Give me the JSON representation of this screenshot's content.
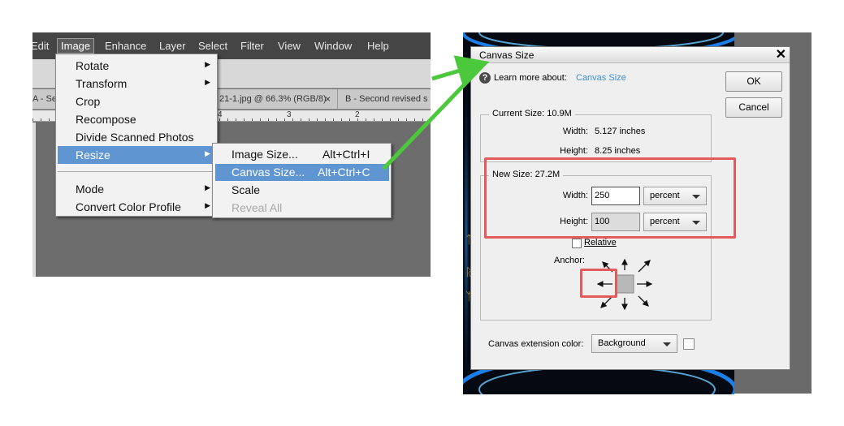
{
  "editor": {
    "menubar": [
      "Edit",
      "Image",
      "Enhance",
      "Layer",
      "Select",
      "Filter",
      "View",
      "Window",
      "Help"
    ],
    "active_menu": "Image",
    "tabs": [
      "A - Se",
      "21-1.jpg @ 66.3% (RGB/8)",
      "×",
      "B - Second revised s"
    ],
    "ruler_numbers": [
      "4",
      "3",
      "2"
    ],
    "image_menu": [
      "Rotate",
      "Transform",
      "Crop",
      "Recompose",
      "Divide Scanned Photos",
      "Resize",
      "Mode",
      "Convert Color Profile"
    ],
    "resize_menu": [
      {
        "label": "Image Size...",
        "shortcut": "Alt+Ctrl+I"
      },
      {
        "label": "Canvas Size...",
        "shortcut": "Alt+Ctrl+C"
      },
      {
        "label": "Scale",
        "shortcut": ""
      },
      {
        "label": "Reveal All",
        "shortcut": ""
      }
    ]
  },
  "dialog": {
    "title": "Canvas Size",
    "close": "✕",
    "learn_more": "Learn more about:",
    "learn_link": "Canvas Size",
    "ok": "OK",
    "cancel": "Cancel",
    "current_size": {
      "legend": "Current Size: 10.9M",
      "width_label": "Width:",
      "width_value": "5.127 inches",
      "height_label": "Height:",
      "height_value": "8.25 inches"
    },
    "new_size": {
      "legend": "New Size: 27.2M",
      "width_label": "Width:",
      "width_value": "250",
      "width_unit": "percent",
      "height_label": "Height:",
      "height_value": "100",
      "height_unit": "percent"
    },
    "relative_label": "Relative",
    "relative_checked": false,
    "anchor_label": "Anchor:",
    "extension_label": "Canvas extension color:",
    "extension_value": "Background"
  },
  "colors": {
    "highlight": "#5f96d2",
    "annotation_red": "#e35a5a",
    "annotation_green": "#4cc83c",
    "link": "#3b8fd6"
  }
}
